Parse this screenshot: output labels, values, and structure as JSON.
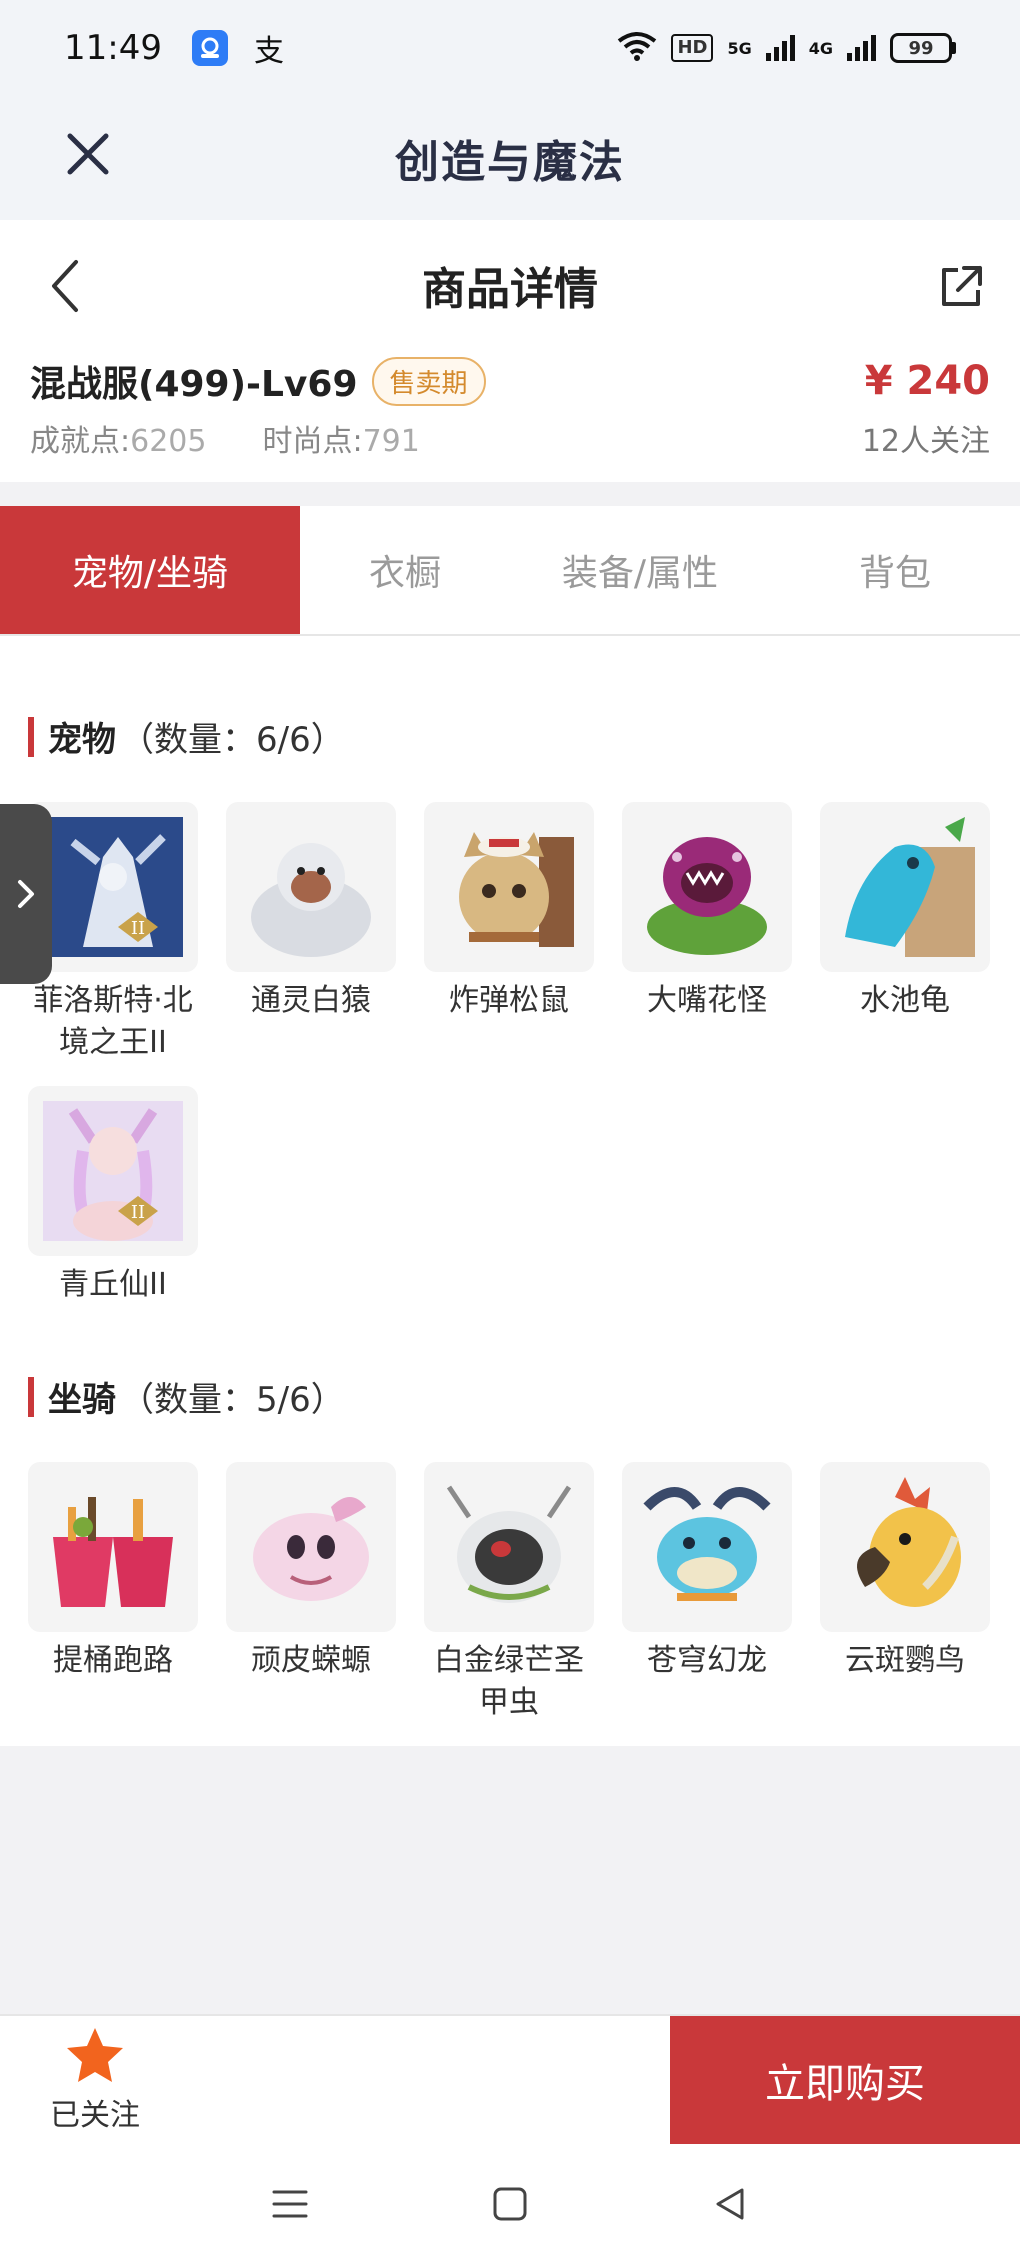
{
  "status_bar": {
    "time": "11:49",
    "app_icon_1": "app-icon",
    "app_icon_2_glyph": "支",
    "hd_label": "HD",
    "net_5g": "5G",
    "net_4g": "4G",
    "battery": "99"
  },
  "app_header": {
    "title": "创造与魔法"
  },
  "detail_nav": {
    "title": "商品详情"
  },
  "product": {
    "name": "混战服(499)-Lv69",
    "badge": "售卖期",
    "price": "¥ 240",
    "achievement_label": "成就点:",
    "achievement_value": "6205",
    "fashion_label": "时尚点:",
    "fashion_value": "791",
    "followers": "12人关注"
  },
  "tabs": [
    {
      "label": "宠物/坐骑",
      "active": true
    },
    {
      "label": "衣橱",
      "active": false
    },
    {
      "label": "装备/属性",
      "active": false
    },
    {
      "label": "背包",
      "active": false
    }
  ],
  "pets_section": {
    "title": "宠物",
    "count": "（数量：6/6）",
    "items": [
      {
        "label": "菲洛斯特·北境之王II",
        "tier": "II"
      },
      {
        "label": "通灵白猿"
      },
      {
        "label": "炸弹松鼠"
      },
      {
        "label": "大嘴花怪"
      },
      {
        "label": "水池龟"
      },
      {
        "label": "青丘仙II",
        "tier": "II"
      }
    ]
  },
  "mounts_section": {
    "title": "坐骑",
    "count": "（数量：5/6）",
    "items": [
      {
        "label": "提桶跑路"
      },
      {
        "label": "顽皮蝾螈"
      },
      {
        "label": "白金绿芒圣甲虫"
      },
      {
        "label": "苍穹幻龙"
      },
      {
        "label": "云斑鹦鸟"
      }
    ]
  },
  "bottom_bar": {
    "follow_label": "已关注",
    "buy_label": "立即购买"
  },
  "colors": {
    "accent": "#c9383a",
    "badge": "#d48a2d",
    "star": "#f2641e"
  }
}
